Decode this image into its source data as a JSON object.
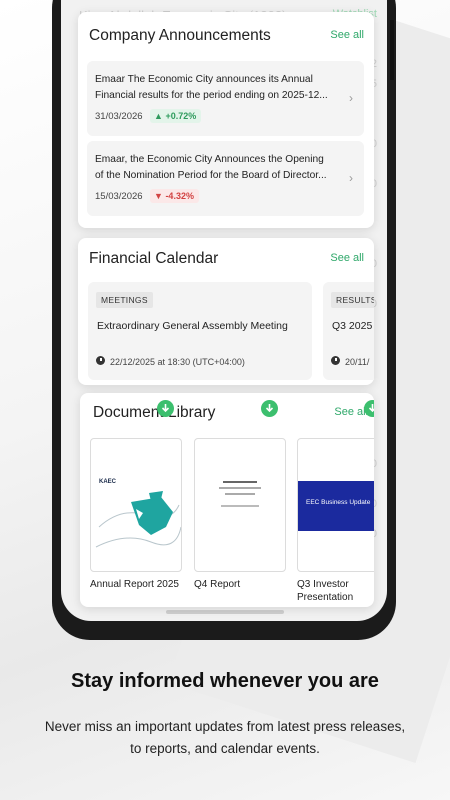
{
  "background_ghost": {
    "top_text": "King Abdullah Economic City (1302)",
    "top_right": "Watchlist",
    "right_values": [
      "52",
      "45",
      "20",
      "00",
      "50",
      "00",
      "50",
      "00",
      "00"
    ]
  },
  "announcements": {
    "title": "Company Announcements",
    "see_all": "See all",
    "items": [
      {
        "text": "Emaar The Economic City announces its Annual Financial results for the period ending on 2025-12...",
        "date": "31/03/2026",
        "change": "+0.72%",
        "direction": "up"
      },
      {
        "text": "Emaar, the Economic City Announces the Opening of the Nomination Period for the Board of Director...",
        "date": "15/03/2026",
        "change": "-4.32%",
        "direction": "down"
      }
    ]
  },
  "calendar": {
    "title": "Financial Calendar",
    "see_all": "See all",
    "events": [
      {
        "tag": "MEETINGS",
        "name": "Extraordinary General Assembly Meeting",
        "datetime": "22/12/2025 at 18:30 (UTC+04:00)"
      },
      {
        "tag": "RESULTS",
        "name": "Q3 2025",
        "datetime": "20/11/"
      }
    ]
  },
  "documents": {
    "title": "Document Library",
    "see_all": "See all",
    "items": [
      {
        "name": "Annual Report 2025",
        "thumb_logo": "KAEC"
      },
      {
        "name": "Q4 Report"
      },
      {
        "name": "Q3 Investor Presentation",
        "thumb_title": "EEC Business Update"
      }
    ]
  },
  "headline": "Stay informed whenever you are",
  "subtext": "Never miss an important updates from latest press releases, to reports, and calendar events.",
  "colors": {
    "accent_green": "#2fa86a",
    "positive": "#2e9b5d",
    "negative": "#d24242",
    "doc_teal": "#1fa5a0",
    "doc_blue": "#1b2a9e"
  }
}
